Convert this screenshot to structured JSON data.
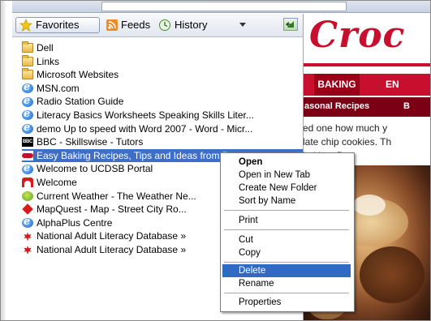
{
  "favorites_pane": {
    "tabs": {
      "favorites": "Favorites",
      "feeds": "Feeds",
      "history": "History"
    },
    "items": [
      {
        "label": "Dell",
        "icon": "folder-icon"
      },
      {
        "label": "Links",
        "icon": "folder-icon"
      },
      {
        "label": "Microsoft Websites",
        "icon": "folder-icon"
      },
      {
        "label": "MSN.com",
        "icon": "ie-page-icon"
      },
      {
        "label": "Radio Station Guide",
        "icon": "ie-page-icon"
      },
      {
        "label": "Literacy Basics Worksheets Speaking Skills  Liter...",
        "icon": "ie-page-icon"
      },
      {
        "label": "demo Up to speed with Word 2007 - Word - Micr...",
        "icon": "ie-page-icon"
      },
      {
        "label": "BBC - Skillswise - Tutors",
        "icon": "bbc-icon"
      },
      {
        "label": "Easy Baking Recipes, Tips and Ideas from Betty...",
        "icon": "betty-crocker-icon"
      },
      {
        "label": "Welcome to UCDSB Portal",
        "icon": "ie-page-icon"
      },
      {
        "label": "Welcome",
        "icon": "arch-logo-icon"
      },
      {
        "label": "Current Weather - The Weather Ne...",
        "icon": "weather-icon"
      },
      {
        "label": "MapQuest - Map - Street  City  Ro...",
        "icon": "mapquest-icon"
      },
      {
        "label": "AlphaPlus Centre",
        "icon": "ie-page-icon"
      },
      {
        "label": "National Adult Literacy Database »",
        "icon": "maple-leaf-icon"
      },
      {
        "label": "National Adult Literacy Database »",
        "icon": "maple-leaf-icon"
      }
    ],
    "selected_index": 8
  },
  "context_menu": {
    "open": "Open",
    "open_new_tab": "Open in New Tab",
    "create_new_folder": "Create New Folder",
    "sort_by_name": "Sort by Name",
    "print": "Print",
    "cut": "Cut",
    "copy": "Copy",
    "delete": "Delete",
    "rename": "Rename",
    "properties": "Properties"
  },
  "webpage": {
    "logo_fragment": "Croc",
    "nav_active": "BAKING",
    "nav_next": "EN",
    "subnav_1": "asonal Recipes",
    "subnav_2": "B",
    "body_lines": [
      "ed one how much y",
      "late chip cookies. Th",
      "baking, Bett"
    ]
  },
  "colors": {
    "brand_red": "#c8102e",
    "selection_blue": "#3d6fc8",
    "menu_highlight": "#316ac5"
  }
}
